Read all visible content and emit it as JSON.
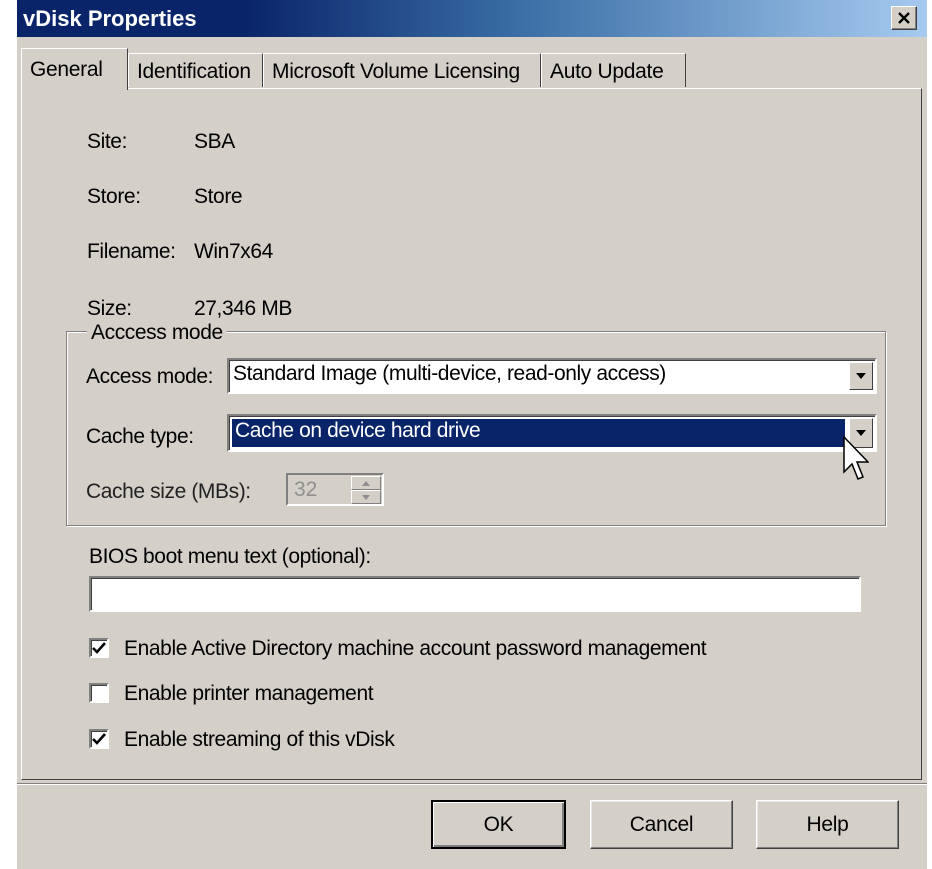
{
  "window": {
    "title": "vDisk Properties",
    "close_label": "×"
  },
  "tabs": [
    {
      "label": "General",
      "active": true
    },
    {
      "label": "Identification",
      "active": false
    },
    {
      "label": "Microsoft Volume Licensing",
      "active": false
    },
    {
      "label": "Auto Update",
      "active": false
    }
  ],
  "info": {
    "site_label": "Site:",
    "site_value": "SBA",
    "store_label": "Store:",
    "store_value": "Store",
    "filename_label": "Filename:",
    "filename_value": "Win7x64",
    "size_label": "Size:",
    "size_value": "27,346 MB"
  },
  "access_group": {
    "legend": "Acccess mode",
    "access_mode_label": "Access mode:",
    "access_mode_value": "Standard Image (multi-device, read-only access)",
    "cache_type_label": "Cache type:",
    "cache_type_value": "Cache on device hard drive",
    "cache_size_label": "Cache size (MBs):",
    "cache_size_value": "32"
  },
  "bios": {
    "label": "BIOS boot menu text (optional):",
    "value": ""
  },
  "options": [
    {
      "label": "Enable Active Directory machine account password management",
      "checked": true
    },
    {
      "label": "Enable printer management",
      "checked": false
    },
    {
      "label": "Enable streaming of this vDisk",
      "checked": true
    }
  ],
  "buttons": {
    "ok": "OK",
    "cancel": "Cancel",
    "help": "Help"
  },
  "colors": {
    "titlebar": "#0a246a",
    "dialog_bg": "#d4d0c8",
    "selection": "#0a246a"
  },
  "icons": {
    "close": "close-icon",
    "dropdown": "chevron-down-icon",
    "checkbox": "checkmark-icon",
    "cursor": "mouse-pointer-icon"
  }
}
